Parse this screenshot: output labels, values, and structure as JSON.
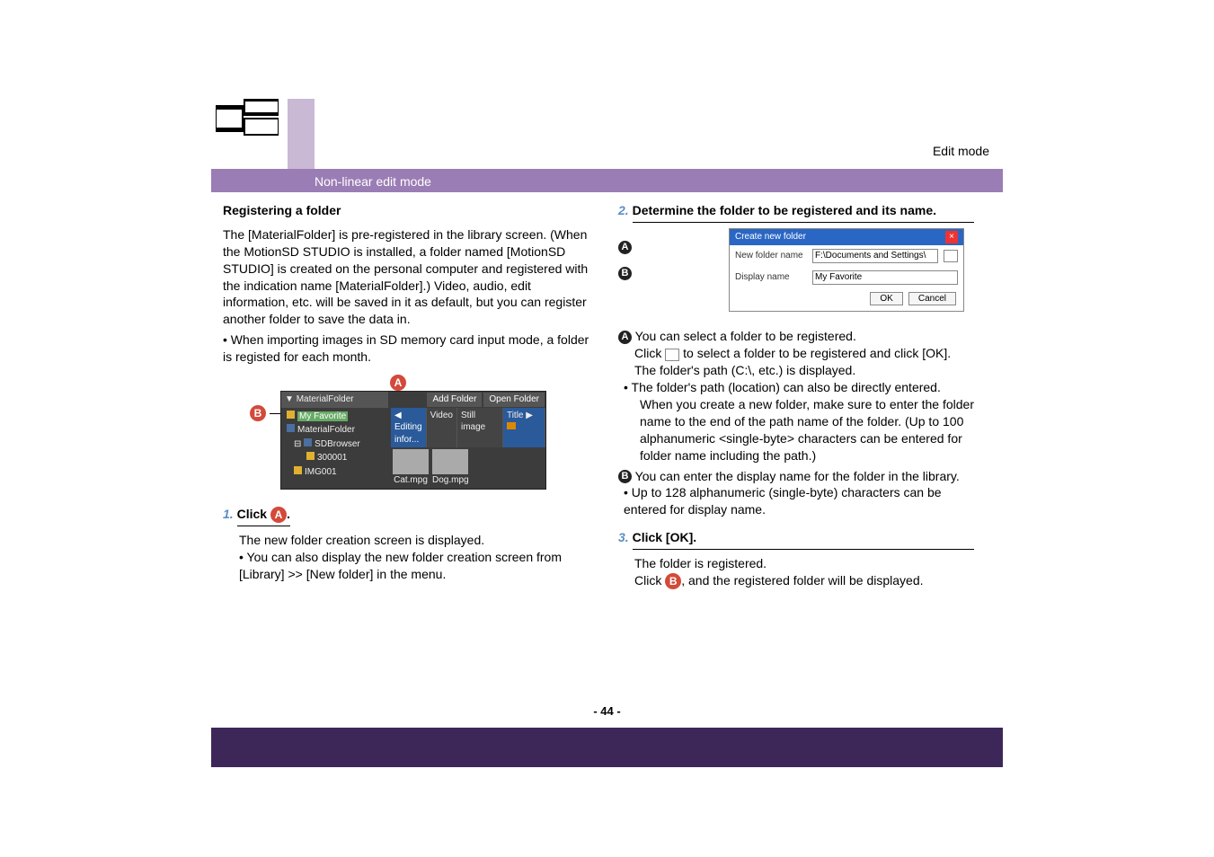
{
  "header": {
    "edit_mode": "Edit mode",
    "banner": "Non-linear edit mode"
  },
  "left": {
    "heading": "Registering a folder",
    "intro": "The [MaterialFolder] is pre-registered in the library screen. (When the MotionSD STUDIO is installed, a folder named [MotionSD STUDIO] is created on the personal computer and registered with the indication name [MaterialFolder].) Video, audio, edit information, etc. will be saved in it as default, but you can register another folder to save the data in.",
    "bullet1": "When importing images in SD memory card input mode, a folder is registed for each month.",
    "step1_num": "1.",
    "step1_title_pre": "Click ",
    "step1_title_post": ".",
    "step1_line1": "The new folder creation screen is displayed.",
    "step1_bullet": "You can also display the new folder creation screen from [Library] >> [New folder] in the menu.",
    "library": {
      "tree_root": "MaterialFolder",
      "tree_sel": "My Favorite",
      "tree_item2": "MaterialFolder",
      "tree_item3": "SDBrowser",
      "tree_item4": "300001",
      "tree_item5": "IMG001",
      "tab_edit": "Editing infor...",
      "tab_video": "Video",
      "tab_still": "Still image",
      "btn_add": "Add Folder",
      "btn_open": "Open Folder",
      "title_lbl": "Title",
      "thumb1": "Cat.mpg",
      "thumb2": "Dog.mpg"
    }
  },
  "right": {
    "step2_num": "2.",
    "step2_title": "Determine the folder to be registered and its name.",
    "dialog": {
      "title": "Create new folder",
      "row_a_label": "New folder name",
      "row_a_value": "F:\\Documents and Settings\\",
      "row_b_label": "Display name",
      "row_b_value": "My Favorite",
      "ok": "OK",
      "cancel": "Cancel"
    },
    "callout_a_line1": "You can select a folder to be registered.",
    "callout_a_click_pre": "Click ",
    "callout_a_click_post": " to select a folder to be registered and click [OK].",
    "callout_a_line3": "The folder's path (C:\\, etc.) is displayed.",
    "callout_a_bullet": "The folder's path (location) can also be directly entered.",
    "callout_a_note": "When you create a new folder, make sure to enter the folder name to the end of the path name of the folder. (Up to 100 alphanumeric <single-byte> characters can be entered for folder name including the path.)",
    "callout_b_line1": "You can enter the display name for the folder in the library.",
    "callout_b_bullet": "Up to 128 alphanumeric (single-byte) characters can be entered for display name.",
    "step3_num": "3.",
    "step3_title": "Click [OK].",
    "step3_line1": "The folder is registered.",
    "step3_line2_pre": "Click ",
    "step3_line2_post": ", and the registered folder will be displayed."
  },
  "footer": {
    "page": "- 44 -"
  }
}
